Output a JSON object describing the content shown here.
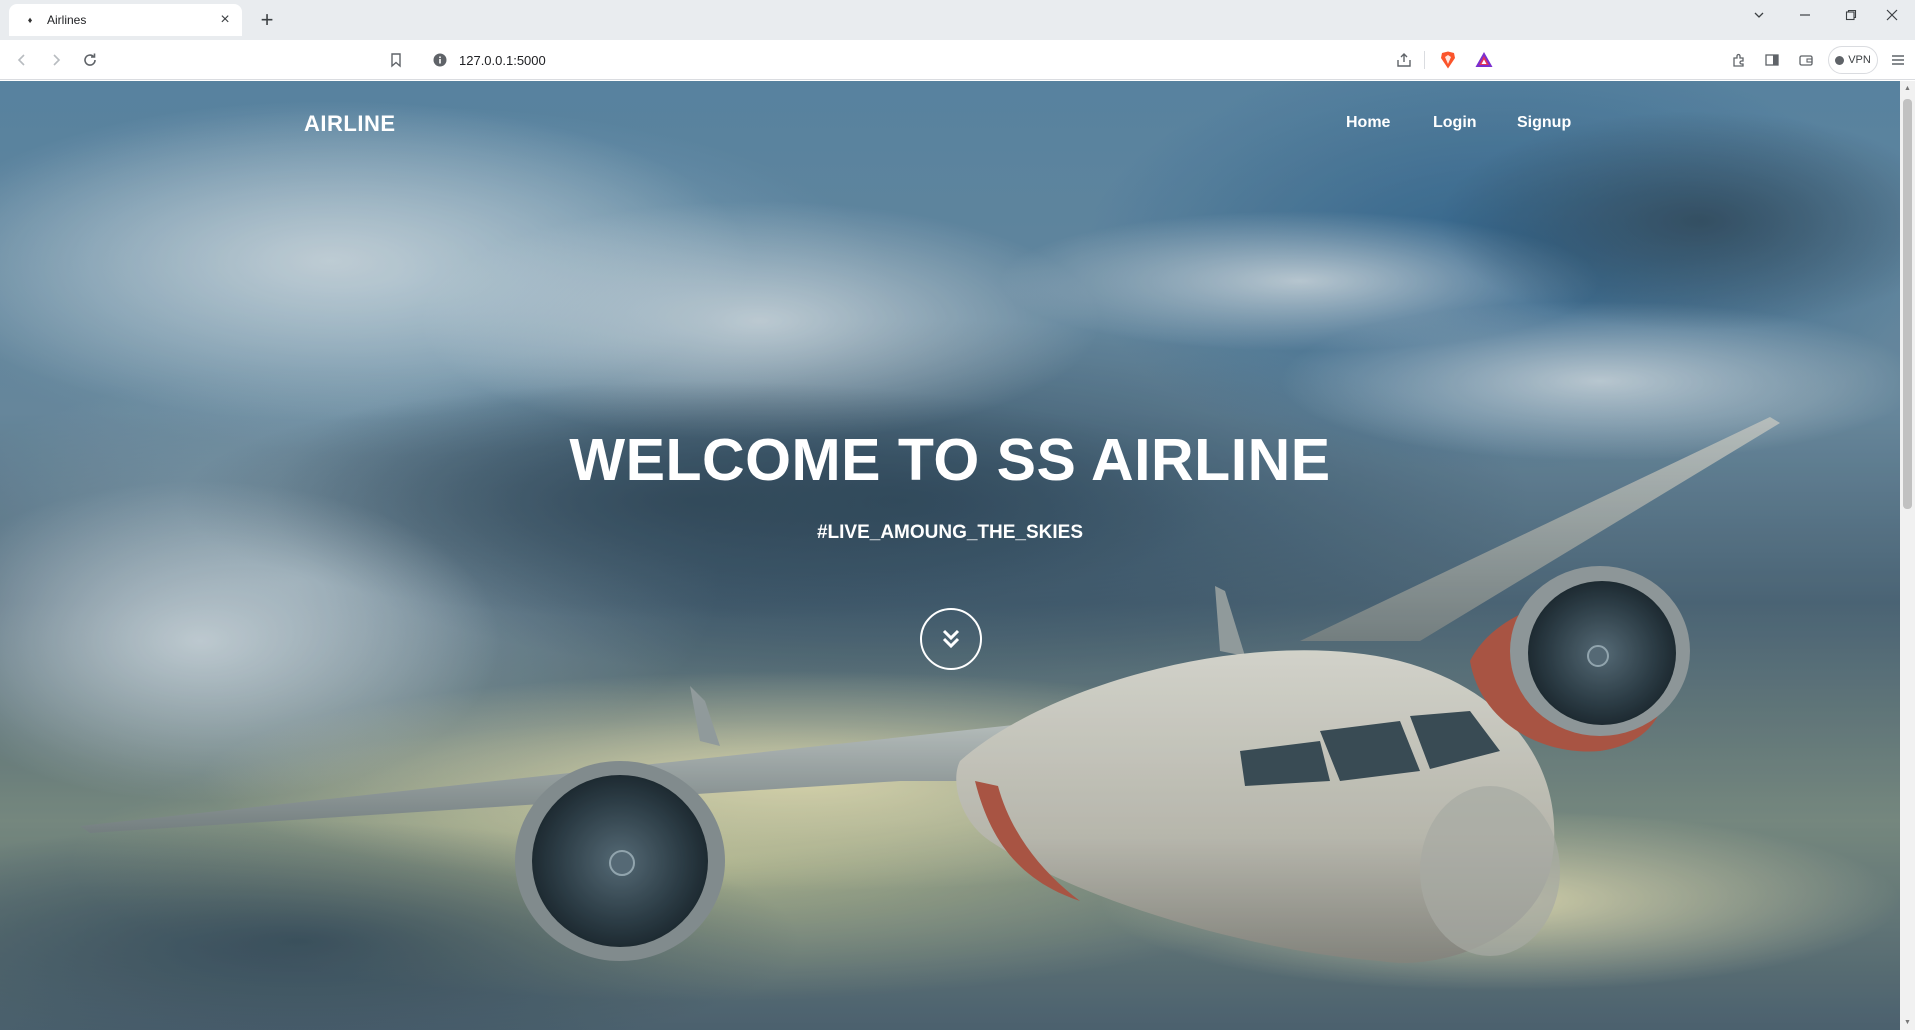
{
  "browser": {
    "tab_title": "Airlines",
    "url": "127.0.0.1:5000",
    "vpn_label": "VPN"
  },
  "site": {
    "brand": "AIRLINE",
    "nav": {
      "home": "Home",
      "login": "Login",
      "signup": "Signup"
    }
  },
  "hero": {
    "title": "WELCOME TO SS AIRLINE",
    "subtitle": "#LIVE_AMOUNG_THE_SKIES",
    "scroll_icon": "double-chevron-down-icon"
  },
  "colors": {
    "text": "#ffffff",
    "sky_dark": "#4e6677",
    "sky_blue": "#5d89a8"
  }
}
